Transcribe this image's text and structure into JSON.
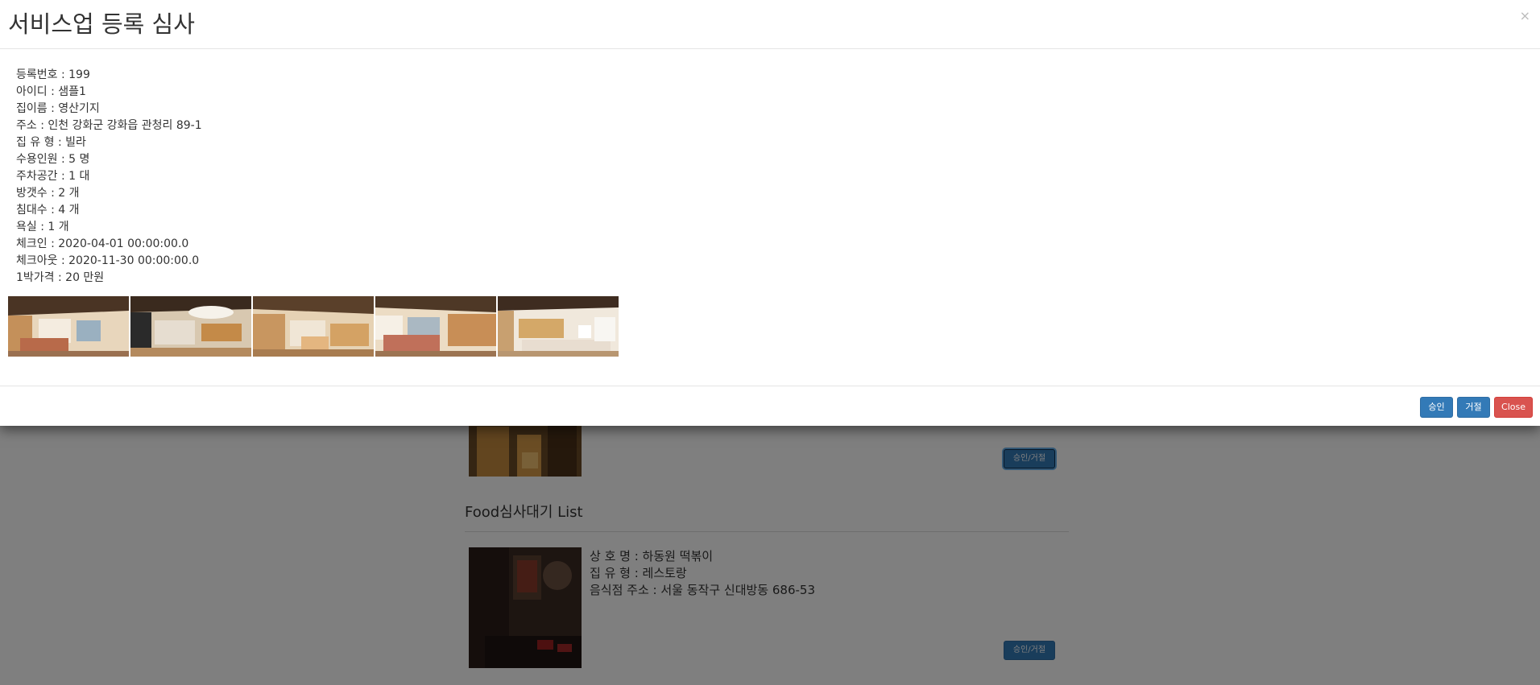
{
  "modal": {
    "title": "서비스업 등록 심사",
    "close_symbol": "×",
    "details": [
      "등록번호 : 199",
      "아이디 : 샘플1",
      "집이름 : 영산기지",
      "주소 : 인천 강화군 강화읍 관청리 89-1",
      "집 유 형 : 빌라",
      "수용인원 : 5 명",
      "주차공간 : 1 대",
      "방갯수 : 2 개",
      "침대수 : 4 개",
      "욕실 : 1 개",
      "체크인 : 2020-04-01 00:00:00.0",
      "체크아웃 : 2020-11-30 00:00:00.0",
      "1박가격 : 20 만원"
    ],
    "footer": {
      "approve_label": "승인",
      "reject_label": "거절",
      "close_label": "Close"
    }
  },
  "background": {
    "lodging_card": {
      "button_label": "승인/거절"
    },
    "food_section": {
      "title": "Food심사대기 List",
      "item": {
        "name_line": "상 호 명 : 하동원 떡볶이",
        "type_line": "집 유 형 : 레스토랑",
        "address_line": "음식점 주소 : 서울 동작구 신대방동 686-53",
        "button_label": "승인/거절"
      }
    }
  },
  "colors": {
    "primary": "#337ab7",
    "danger": "#d9534f",
    "backdrop": "rgba(0,0,0,0.5)"
  }
}
